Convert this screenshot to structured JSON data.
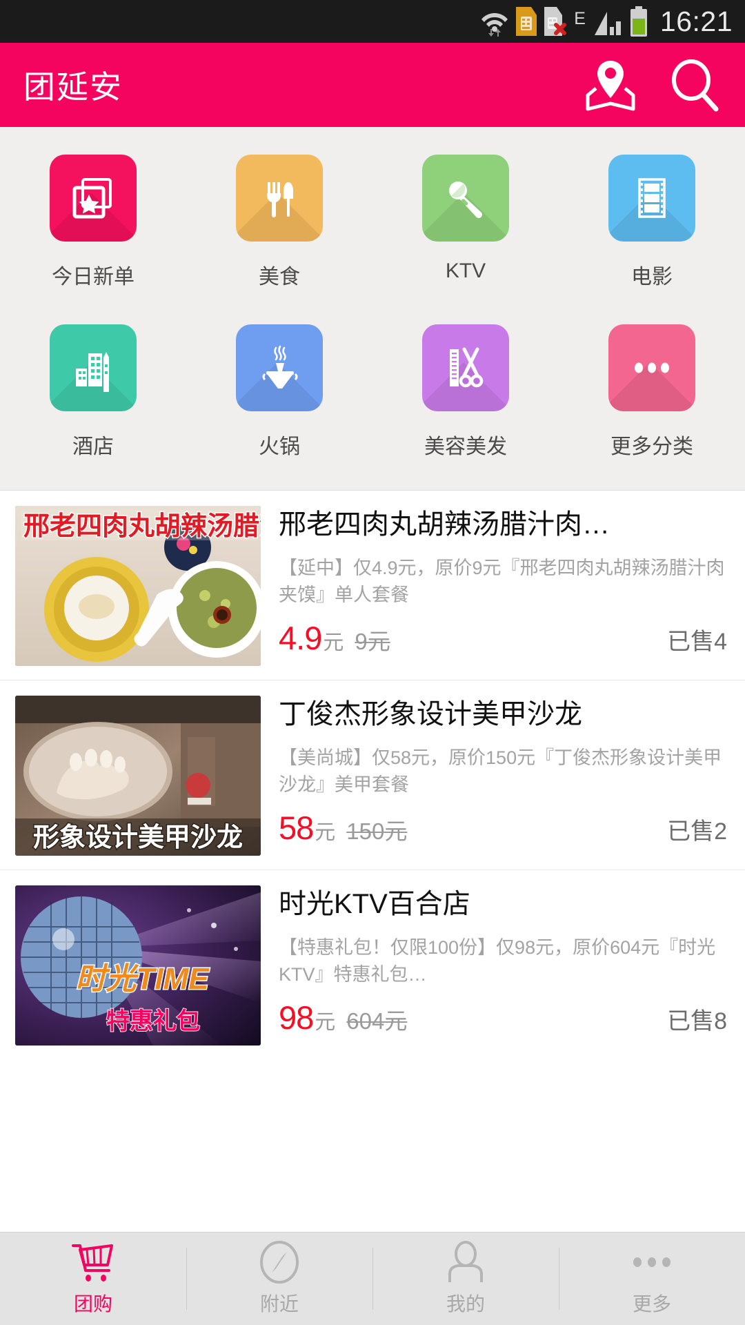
{
  "statusbar": {
    "time": "16:21",
    "icons": [
      "wifi-icon",
      "sim-card-icon",
      "sim-card-error-icon",
      "edge-network-icon",
      "signal-icon",
      "battery-icon"
    ],
    "network_label": "E"
  },
  "header": {
    "title": "团延安",
    "location_icon": "location-pin-icon",
    "search_icon": "search-icon",
    "bg_color": "#f4045e"
  },
  "categories": [
    {
      "label": "今日新单",
      "icon": "star-cards-icon",
      "color": "#f4115e"
    },
    {
      "label": "美食",
      "icon": "fork-knife-icon",
      "color": "#f3b95d"
    },
    {
      "label": "KTV",
      "icon": "microphone-icon",
      "color": "#8fd07a"
    },
    {
      "label": "电影",
      "icon": "film-strip-icon",
      "color": "#5dbcf0"
    },
    {
      "label": "酒店",
      "icon": "buildings-icon",
      "color": "#3ecaa8"
    },
    {
      "label": "火锅",
      "icon": "hotpot-icon",
      "color": "#6f9ef0"
    },
    {
      "label": "美容美发",
      "icon": "scissors-comb-icon",
      "color": "#c77ae8"
    },
    {
      "label": "更多分类",
      "icon": "ellipsis-icon",
      "color": "#f2668f"
    }
  ],
  "deals": [
    {
      "title": "邢老四肉丸胡辣汤腊汁肉…",
      "description": "【延中】仅4.9元，原价9元『邢老四肉丸胡辣汤腊汁肉夹馍』单人套餐",
      "price": "4.9",
      "price_unit": "元",
      "original_price": "9元",
      "sold": "已售4",
      "thumb_caption": "邢老四肉丸胡辣汤腊汁肉夹馍",
      "thumb_alt": "food-photo-soup-and-bun"
    },
    {
      "title": "丁俊杰形象设计美甲沙龙",
      "description": "【美尚城】仅58元，原价150元『丁俊杰形象设计美甲沙龙』美甲套餐",
      "price": "58",
      "price_unit": "元",
      "original_price": "150元",
      "sold": "已售2",
      "thumb_caption": "形象设计美甲沙龙",
      "thumb_alt": "nail-salon-photo"
    },
    {
      "title": "时光KTV百合店",
      "description": "【特惠礼包！仅限100份】仅98元，原价604元『时光KTV』特惠礼包…",
      "price": "98",
      "price_unit": "元",
      "original_price": "604元",
      "sold": "已售8",
      "thumb_caption": "时光TIME 特惠礼包",
      "thumb_alt": "ktv-disco-ball-photo"
    }
  ],
  "tabbar": [
    {
      "label": "团购",
      "icon": "shopping-cart-icon",
      "active": true
    },
    {
      "label": "附近",
      "icon": "compass-icon",
      "active": false
    },
    {
      "label": "我的",
      "icon": "person-icon",
      "active": false
    },
    {
      "label": "更多",
      "icon": "ellipsis-icon",
      "active": false
    }
  ],
  "colors": {
    "accent": "#f4045e",
    "price_red": "#f30f25",
    "muted": "#a3a3a3"
  }
}
